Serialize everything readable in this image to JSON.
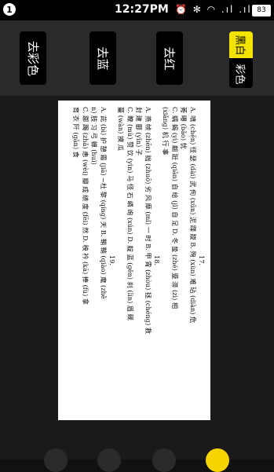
{
  "status_bar": {
    "notification_count": "1",
    "time": "12:27PM",
    "icons": "⏰ ✻ ◠ .ıl .ıl",
    "battery": "83"
  },
  "toolbar": {
    "buttons": [
      "去彩色",
      "去蓝",
      "去红"
    ],
    "toggle": [
      "黑白",
      "彩色"
    ]
  },
  "document": {
    "lines": [
      "17.",
      "A. 嗔 (chēn) 怪 瑟 (dài) 武 佝 (xūn) 泥 蹀 躞  B. 殉 (xùn) 难 玷 (diàn) 危",
      "莠 曝 (bǎo) 忧",
      "C. 蠕 蝎 (yì) 翩 跹 (qiān) 自 给 (jǐ) 自 足  D. 冬 蛰 (zhé) 蹙 滞 (zì) 相",
      "(xiǎng) 机 行 事",
      "18.",
      "A. 燕 帧 (zhēn) 拙 (zhuō) 劣 风 靡 (mǐ) 一 时  B. 甲 胄 (zhòu) 拯 (chéng) 救",
      "封 建 郾 (yīn) 子",
      "C. 瞭 (mù) 赞 饮 (yìn) 马 怪 石 嶙 峋 (xún)  D. 靛 蓝 (gěn) 刹 (lìn) 眉 觋",
      "蔓 (wàn) 摸 瓜",
      "19.",
      "A. 茈 (bì) 护 憩 霜 (jiā) ~杜 黎 (qíng) 天  B. 鞘 鞘 (qiào) 麾 (zhě",
      "n) 肢 习 弓 蝉 (huì)",
      "C. 踯 躅 (zhǎ) 恚 (wèi) 瓣 成 绩 度 (fēi) 然  D. 秧 衿 (kā) 捧 (fù) 拿",
      "育 衣 阡 (gān) 食"
    ]
  }
}
